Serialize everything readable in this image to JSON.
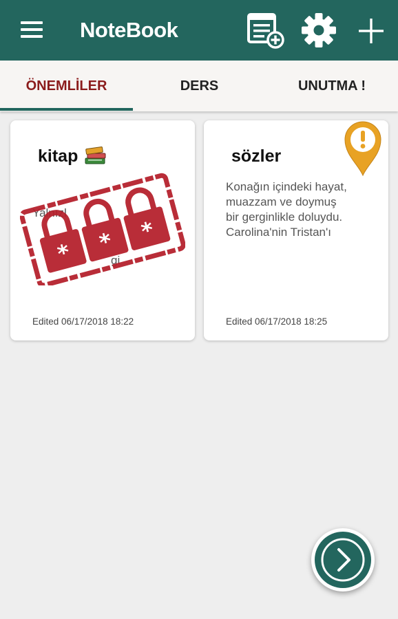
{
  "app": {
    "title": "NoteBook",
    "theme_color": "#23665e",
    "accent_color": "#8b1c1c",
    "toolbar_icons": [
      "menu-icon",
      "new-note-list-icon",
      "gear-icon",
      "plus-icon"
    ]
  },
  "tabs": [
    {
      "label": "ÖNEMLİLER",
      "active": true
    },
    {
      "label": "DERS",
      "active": false
    },
    {
      "label": "UNUTMA !",
      "active": false
    }
  ],
  "notes": [
    {
      "title": "kitap",
      "title_icon": "books-icon",
      "locked": true,
      "preview_fragments": [
        "Yalnızl",
        "gi"
      ],
      "edited": "Edited 06/17/2018 18:22"
    },
    {
      "title": "sözler",
      "pinned_icon": "alert-pin-icon",
      "body_lines": [
        "Konağın içindeki hayat,",
        "muazzam ve doymuş",
        "bir gerginlikle doluydu.",
        "Carolina'nin Tristan'ı"
      ],
      "edited": "Edited 06/17/2018 18:25"
    }
  ],
  "fab": {
    "icon": "chevron-right-icon"
  }
}
